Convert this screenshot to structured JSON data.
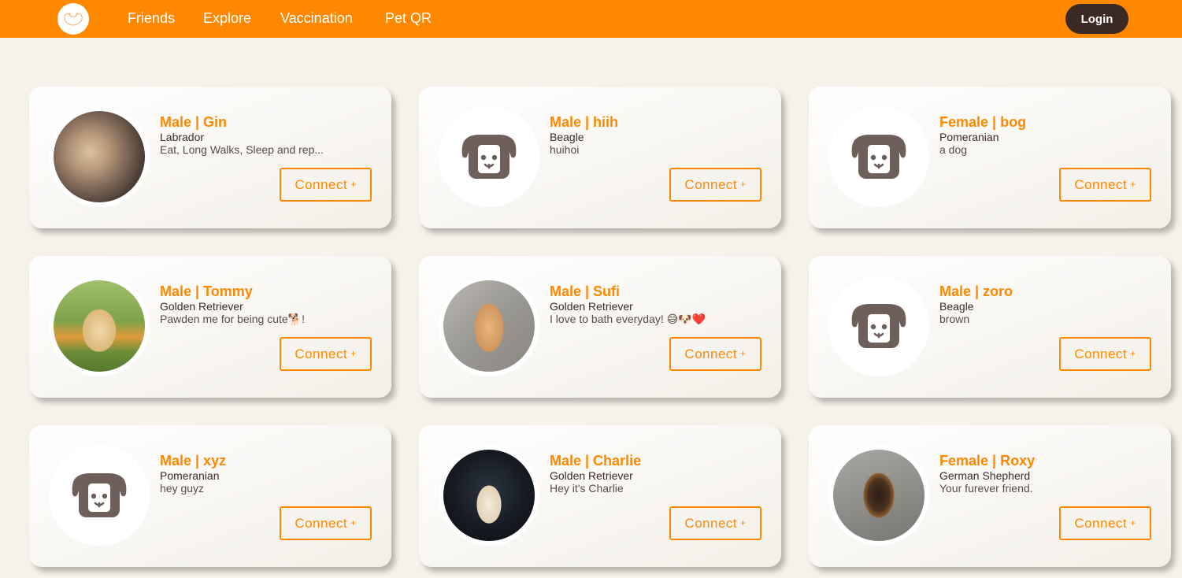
{
  "nav": {
    "links": [
      "Friends",
      "Explore",
      "Vaccination",
      "Pet QR"
    ],
    "login_label": "Login"
  },
  "colors": {
    "brand": "#ff8800",
    "dark": "#3b2a24",
    "background": "#f6f1e9",
    "placeholder_icon": "#6e5f5b"
  },
  "connect_label": "Connect",
  "connect_symbol": "+",
  "cards": [
    {
      "title": "Male | Gin",
      "breed": "Labrador",
      "desc": "Eat, Long Walks, Sleep and rep...",
      "photo": "sleeping-puppy-photo"
    },
    {
      "title": "Male | hiih",
      "breed": "Beagle",
      "desc": "huihoi",
      "photo": "placeholder-dog-icon"
    },
    {
      "title": "Female | bog",
      "breed": "Pomeranian",
      "desc": "a dog",
      "photo": "placeholder-dog-icon"
    },
    {
      "title": "Male | Tommy",
      "breed": "Golden Retriever",
      "desc": "Pawden me for being cute🐕!",
      "photo": "golden-puppy-grass-photo"
    },
    {
      "title": "Male | Sufi",
      "breed": "Golden Retriever",
      "desc": "I love to bath everyday! 😅🐶❤️",
      "photo": "golden-puppy-sitting-photo"
    },
    {
      "title": "Male | zoro",
      "breed": "Beagle",
      "desc": "brown",
      "photo": "placeholder-dog-icon"
    },
    {
      "title": "Male | xyz",
      "breed": "Pomeranian",
      "desc": "hey guyz",
      "photo": "placeholder-dog-icon"
    },
    {
      "title": "Male | Charlie",
      "breed": "Golden Retriever",
      "desc": "Hey it's Charlie",
      "photo": "labrador-dark-background-photo"
    },
    {
      "title": "Female | Roxy",
      "breed": "German Shepherd",
      "desc": "Your furever friend.",
      "photo": "german-shepherd-puppy-photo"
    }
  ]
}
